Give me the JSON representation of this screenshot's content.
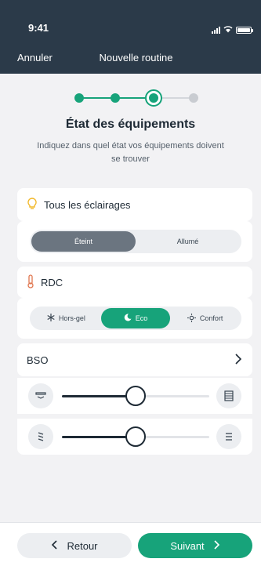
{
  "status_bar": {
    "time": "9:41"
  },
  "nav": {
    "cancel_label": "Annuler",
    "title": "Nouvelle routine"
  },
  "stepper": {
    "total_steps": 4,
    "current_step": 3
  },
  "page": {
    "title": "État des équipements",
    "subtitle": "Indiquez dans quel état vos équipements doivent se trouver"
  },
  "lighting": {
    "label": "Tous les éclairages",
    "icon": "lightbulb-icon",
    "options": [
      "Éteint",
      "Allumé"
    ],
    "selected": "Éteint"
  },
  "heating": {
    "label": "RDC",
    "icon": "thermometer-icon",
    "options": [
      {
        "label": "Hors-gel",
        "icon": "snowflake-icon"
      },
      {
        "label": "Eco",
        "icon": "moon-icon"
      },
      {
        "label": "Confort",
        "icon": "sun-icon"
      }
    ],
    "selected": "Eco"
  },
  "bso": {
    "label": "BSO",
    "sliders": [
      {
        "left_icon": "blind-open-icon",
        "right_icon": "blind-closed-icon",
        "value": 0.5
      },
      {
        "left_icon": "slats-tilt-icon",
        "right_icon": "slats-flat-icon",
        "value": 0.5
      }
    ]
  },
  "footer": {
    "back_label": "Retour",
    "next_label": "Suivant"
  },
  "colors": {
    "header": "#2b3a49",
    "accent": "#17a37a",
    "text": "#1e2a35"
  }
}
